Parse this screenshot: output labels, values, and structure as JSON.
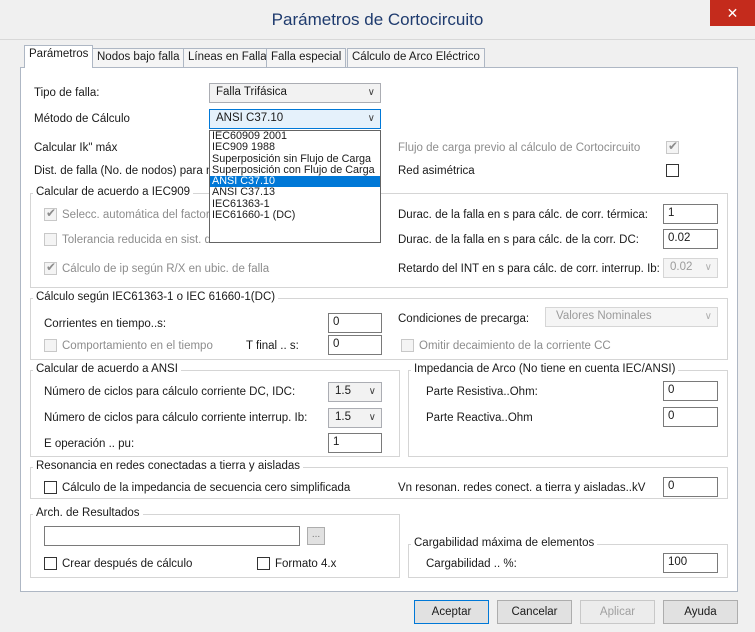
{
  "window": {
    "title": "Parámetros de Cortocircuito",
    "close_icon": "close-icon"
  },
  "tabs": [
    "Parámetros",
    "Nodos bajo falla",
    "Líneas en Falla",
    "Falla especial",
    "Cálculo de Arco Eléctrico"
  ],
  "general": {
    "fault_type_label": "Tipo de falla:",
    "fault_type_value": "Falla Trifásica",
    "method_label": "Método de Cálculo",
    "method_value": "ANSI C37.10",
    "method_options": [
      "IEC60909 2001",
      "IEC909 1988",
      "Superposición sin Flujo de Carga",
      "Superposición con Flujo de Carga",
      "ANSI C37.10",
      "ANSI C37.13",
      "IEC61363-1",
      "IEC61660-1 (DC)"
    ],
    "ik_max_label": "Calcular Ik\" máx",
    "fault_dist_label": "Dist. de falla (No. de nodos) para mo",
    "loadflow_label": "Flujo de carga previo al cálculo de Cortocircuito",
    "asym_label": "Red asimétrica"
  },
  "iec909": {
    "title": "Calcular de acuerdo a IEC909",
    "auto_factor": "Selecc. automática del factor c",
    "reduced_tol": "Tolerancia reducida en sist. de",
    "ip_calc": "Cálculo de ip según R/X en ubic. de falla",
    "thermal_label": "Durac. de la falla en s para cálc. de corr. térmica:",
    "thermal_value": "1",
    "dc_label": "Durac. de la falla en s para cálc. de la corr. DC:",
    "dc_value": "0.02",
    "delay_label": "Retardo del INT en s para cálc. de corr. interrup. Ib:",
    "delay_value": "0.02"
  },
  "iec61363": {
    "title": "Cálculo según IEC61363-1 o IEC 61660-1(DC)",
    "currents_label": "Corrientes en tiempo..s:",
    "currents_value": "0",
    "behavior_label": "Comportamiento en el tiempo",
    "tfinal_label": "T final .. s:",
    "tfinal_value": "0",
    "preload_label": "Condiciones de precarga:",
    "preload_value": "Valores Nominales",
    "omit_label": "Omitir decaimiento de la corriente CC"
  },
  "ansi": {
    "title": "Calcular de acuerdo a ANSI",
    "cycles_dc_label": "Número de ciclos para cálculo corriente DC, IDC:",
    "cycles_dc_value": "1.5",
    "cycles_ib_label": "Número de ciclos para cálculo corriente interrup. Ib:",
    "cycles_ib_value": "1.5",
    "eop_label": "E operación .. pu:",
    "eop_value": "1"
  },
  "arc": {
    "title": "Impedancia de Arco (No tiene en cuenta IEC/ANSI)",
    "resistive_label": "Parte Resistiva..Ohm:",
    "resistive_value": "0",
    "reactive_label": "Parte Reactiva..Ohm",
    "reactive_value": "0"
  },
  "resonance": {
    "title": "Resonancia en redes conectadas a tierra y aisladas",
    "zero_seq_label": "Cálculo de la impedancia de secuencia cero simplificada",
    "vn_label": "Vn resonan. redes conect. a tierra y aisladas..kV",
    "vn_value": "0"
  },
  "results": {
    "title": "Arch. de Resultados",
    "file_value": "",
    "browse_label": "...",
    "create_after_label": "Crear después de cálculo",
    "format_label": "Formato 4.x"
  },
  "loadability": {
    "title": "Cargabilidad máxima de elementos",
    "label": "Cargabilidad .. %:",
    "value": "100"
  },
  "buttons": {
    "accept": "Aceptar",
    "cancel": "Cancelar",
    "apply": "Aplicar",
    "help": "Ayuda"
  }
}
